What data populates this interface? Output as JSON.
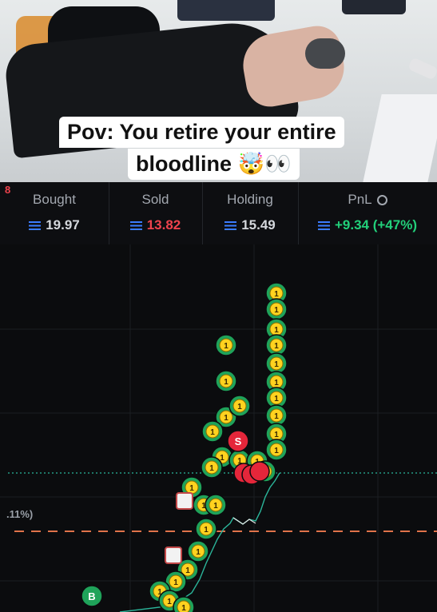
{
  "caption": {
    "line1": "Pov: You retire your entire",
    "line2": "bloodline 🤯👀"
  },
  "stats": [
    {
      "label": "Bought",
      "value": "19.97"
    },
    {
      "label": "Sold",
      "value": "13.82"
    },
    {
      "label": "Holding",
      "value": "15.49"
    },
    {
      "label": "PnL",
      "value": "+9.34 (+47%)"
    }
  ],
  "chart": {
    "top_left_label": ".11%)",
    "marker_labels": {
      "buy": "B",
      "sell": "S",
      "coin": "1"
    }
  },
  "colors": {
    "buy_marker": "#1fa35a",
    "sell_marker": "#e5263a",
    "coin": "#ffd21f",
    "pnl": "#22d07a",
    "loss": "#f0434d",
    "baseline": "#e0734a",
    "dotted_line": "#2bb59a"
  }
}
